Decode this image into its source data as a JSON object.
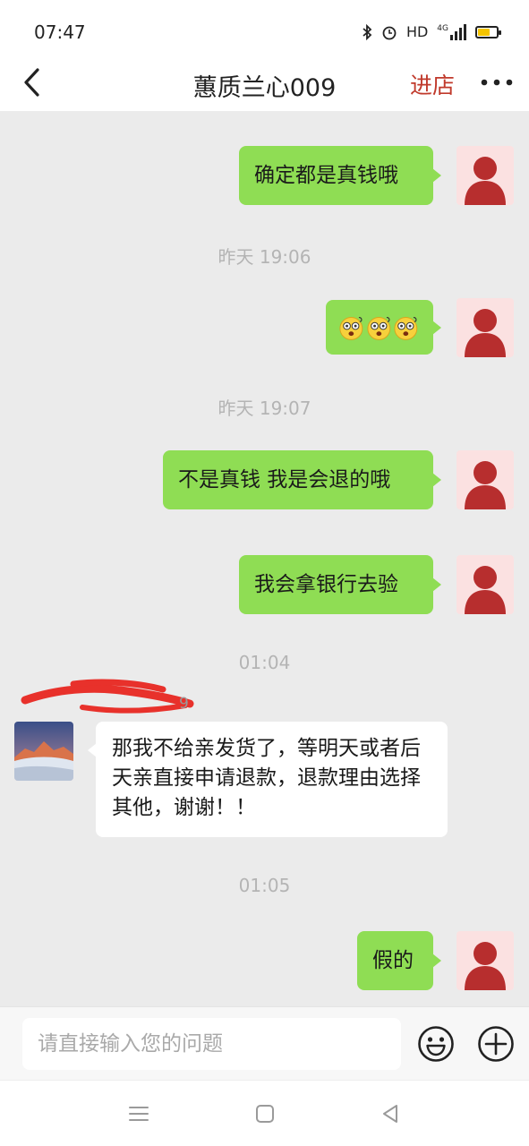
{
  "status_bar": {
    "time": "07:47",
    "network": "HD",
    "signal": "4G"
  },
  "header": {
    "title": "蕙质兰心009",
    "store_link": "进店"
  },
  "messages": [
    {
      "direction": "out",
      "text": "确定都是真钱哦"
    },
    {
      "timestamp": "昨天 19:06"
    },
    {
      "direction": "out",
      "emoji_count": 3,
      "emoji": "dizzy-face-emoji"
    },
    {
      "timestamp": "昨天 19:07"
    },
    {
      "direction": "out",
      "text": "不是真钱 我是会退的哦"
    },
    {
      "direction": "out",
      "text": "我会拿银行去验"
    },
    {
      "timestamp": "01:04"
    },
    {
      "direction": "in",
      "sender_visible": "9",
      "text": "那我不给亲发货了，等明天或者后天亲直接申请退款，退款理由选择其他，谢谢！！"
    },
    {
      "timestamp": "01:05"
    },
    {
      "direction": "out",
      "text": "假的"
    }
  ],
  "input": {
    "placeholder": "请直接输入您的问题"
  },
  "colors": {
    "accent": "#c0392b",
    "outgoing_bubble": "#8fdd54",
    "chat_background": "#ebebeb"
  }
}
